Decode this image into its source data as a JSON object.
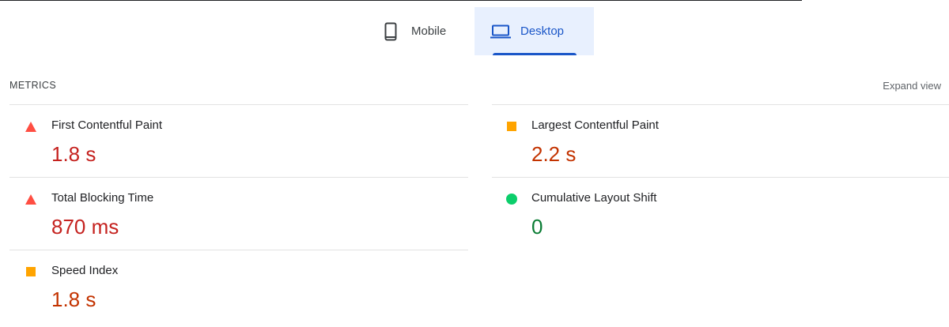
{
  "tabs": {
    "mobile": {
      "label": "Mobile",
      "icon": "smartphone-icon",
      "selected": false
    },
    "desktop": {
      "label": "Desktop",
      "icon": "laptop-icon",
      "selected": true
    }
  },
  "metrics_section": {
    "title": "METRICS",
    "expand_label": "Expand view"
  },
  "colors": {
    "accent": "#1a56c8",
    "fail": "#ff4e42",
    "average": "#ffa400",
    "pass": "#0cce6b"
  },
  "metrics": {
    "fcp": {
      "label": "First Contentful Paint",
      "value": "1.8 s",
      "rating": "fail",
      "icon": "red-triangle-icon"
    },
    "tbt": {
      "label": "Total Blocking Time",
      "value": "870 ms",
      "rating": "fail",
      "icon": "red-triangle-icon"
    },
    "si": {
      "label": "Speed Index",
      "value": "1.8 s",
      "rating": "average",
      "icon": "orange-square-icon"
    },
    "lcp": {
      "label": "Largest Contentful Paint",
      "value": "2.2 s",
      "rating": "average",
      "icon": "orange-square-icon"
    },
    "cls": {
      "label": "Cumulative Layout Shift",
      "value": "0",
      "rating": "pass",
      "icon": "green-circle-icon"
    }
  }
}
